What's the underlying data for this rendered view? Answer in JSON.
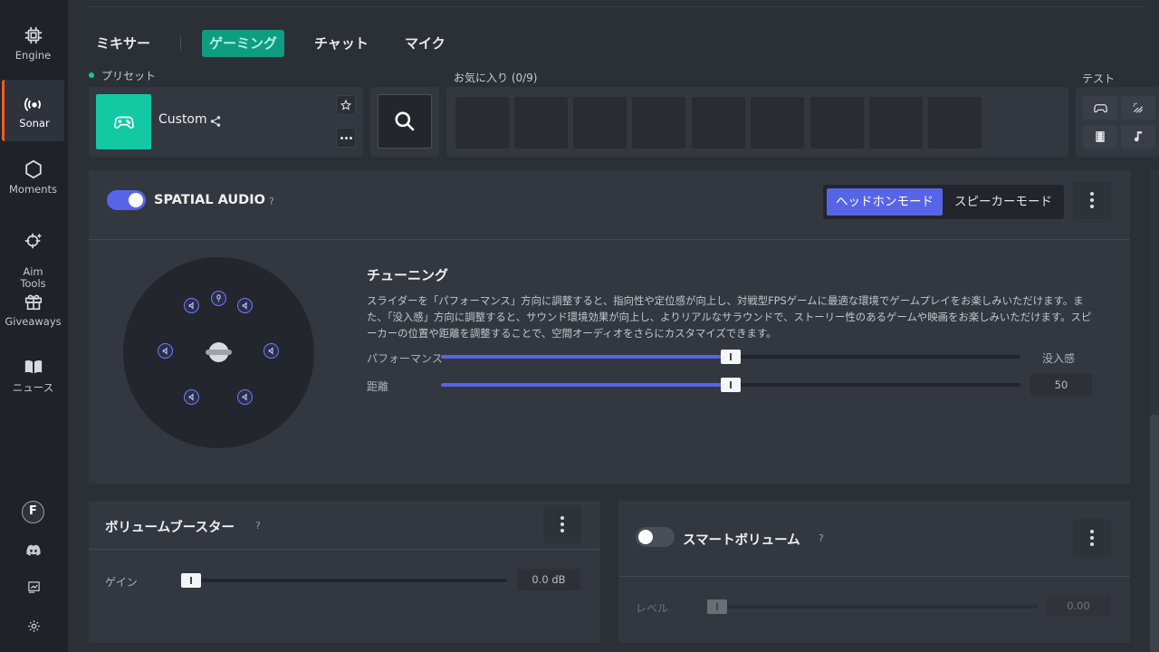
{
  "sidebar": {
    "items": [
      {
        "label": "Engine",
        "icon": "chip-icon"
      },
      {
        "label": "Sonar",
        "icon": "sonar-icon"
      },
      {
        "label": "Moments",
        "icon": "hexagon-icon"
      },
      {
        "label": "Aim\nTools",
        "icon": "crosshair-icon"
      },
      {
        "label": "Giveaways",
        "icon": "gift-icon"
      },
      {
        "label": "ニュース",
        "icon": "book-icon"
      }
    ],
    "active": "Sonar",
    "avatar_letter": "F",
    "bottom_icons": [
      "discord-icon",
      "feedback-icon",
      "settings-icon"
    ]
  },
  "tabs": {
    "mixer": "ミキサー",
    "gaming": "ゲーミング",
    "chat": "チャット",
    "mic": "マイク",
    "active": "ゲーミング"
  },
  "preset": {
    "label": "プリセット",
    "name": "Custom",
    "icon": "gamepad-icon"
  },
  "favorites": {
    "label": "お気に入り (0/9)",
    "slots": 9
  },
  "test": {
    "label": "テスト",
    "buttons": [
      "gamepad-icon",
      "effect-icon",
      "film-icon",
      "music-note-icon"
    ]
  },
  "spatial": {
    "title": "SPATIAL AUDIO",
    "help": "?",
    "enabled": true,
    "modes": [
      "ヘッドホンモード",
      "スピーカーモード"
    ],
    "active_mode": "ヘッドホンモード",
    "tuning_title": "チューニング",
    "tuning_desc": "スライダーを「パフォーマンス」方向に調整すると、指向性や定位感が向上し、対戦型FPSゲームに最適な環境でゲームプレイをお楽しみいただけます。また、「没入感」方向に調整すると、サウンド環境効果が向上し、よりリアルなサラウンドで、ストーリー性のあるゲームや映画をお楽しみいただけます。スピーカーの位置や距離を調整することで、空間オーディオをさらにカスタマイズできます。",
    "performance_label": "パフォーマンス",
    "immersion_label": "没入感",
    "balance": 50,
    "distance_label": "距離",
    "distance": 50,
    "distance_value": "50"
  },
  "volume_booster": {
    "title": "ボリュームブースター",
    "help": "?",
    "gain_label": "ゲイン",
    "gain_value": "0.0 dB",
    "gain": 0
  },
  "smart_volume": {
    "title": "スマートボリューム",
    "help": "?",
    "enabled": false,
    "level_label": "レベル",
    "level_value": "0.00",
    "level": 0
  },
  "colors": {
    "accent_green": "#0f9d82",
    "accent_blue": "#5665e8",
    "active_orange": "#ff5a1f"
  }
}
